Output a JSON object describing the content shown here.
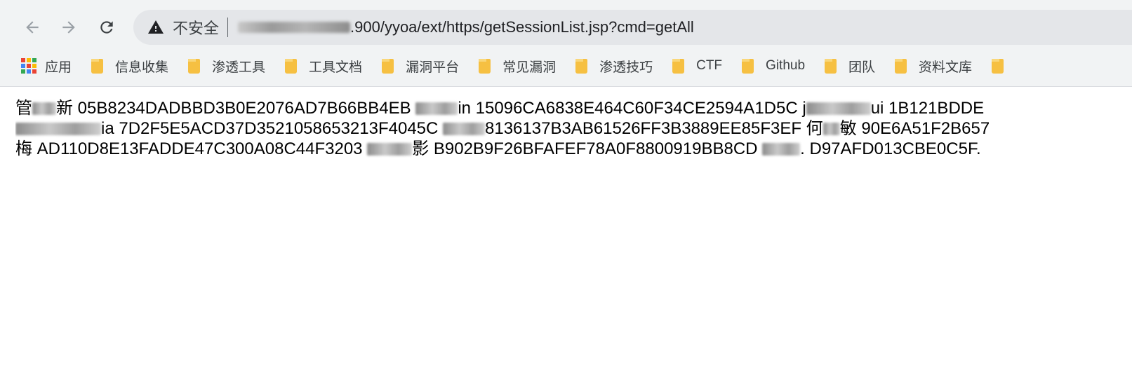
{
  "browser": {
    "nav": {
      "back_icon": "arrow-left-icon",
      "forward_icon": "arrow-right-icon",
      "reload_icon": "reload-icon"
    },
    "address_bar": {
      "security_icon": "warning-triangle-icon",
      "security_text": "不安全",
      "url_visible": ".900/yyoa/ext/https/getSessionList.jsp?cmd=getAll"
    },
    "bookmarks": [
      {
        "label": "应用",
        "icon": "apps-grid-icon"
      },
      {
        "label": "信息收集",
        "icon": "folder-icon"
      },
      {
        "label": "渗透工具",
        "icon": "folder-icon"
      },
      {
        "label": "工具文档",
        "icon": "folder-icon"
      },
      {
        "label": "漏洞平台",
        "icon": "folder-icon"
      },
      {
        "label": "常见漏洞",
        "icon": "folder-icon"
      },
      {
        "label": "渗透技巧",
        "icon": "folder-icon"
      },
      {
        "label": "CTF",
        "icon": "folder-icon"
      },
      {
        "label": "Github",
        "icon": "folder-icon"
      },
      {
        "label": "团队",
        "icon": "folder-icon"
      },
      {
        "label": "资料文库",
        "icon": "folder-icon"
      }
    ]
  },
  "page": {
    "lines": [
      {
        "seg1": "管",
        "seg2": "新 05B8234DADBBD3B0E2076AD7B66BB4EB",
        "seg3": "in 15096CA6838E464C60F34CE2594A1D5C j",
        "seg4": "ui 1B121BDDE"
      },
      {
        "seg1": "ia 7D2F5E5ACD37D3521058653213F4045C",
        "seg2": "8136137B3AB61526FF3B3889EE85F3EF 何",
        "seg3": "敏 90E6A51F2B657"
      },
      {
        "seg1": "梅 AD110D8E13FADDE47C300A08C44F3203",
        "seg2": "影 B902B9F26BFAFEF78A0F8800919BB8CD",
        "seg3": ". D97AFD013CBE0C5F."
      }
    ]
  },
  "colors": {
    "toolbar_bg": "#f1f3f4",
    "omnibox_bg": "#e4e6e9",
    "folder": "#f6c042",
    "apps": [
      "#ea4335",
      "#fbbc04",
      "#34a853",
      "#4285f4"
    ]
  }
}
